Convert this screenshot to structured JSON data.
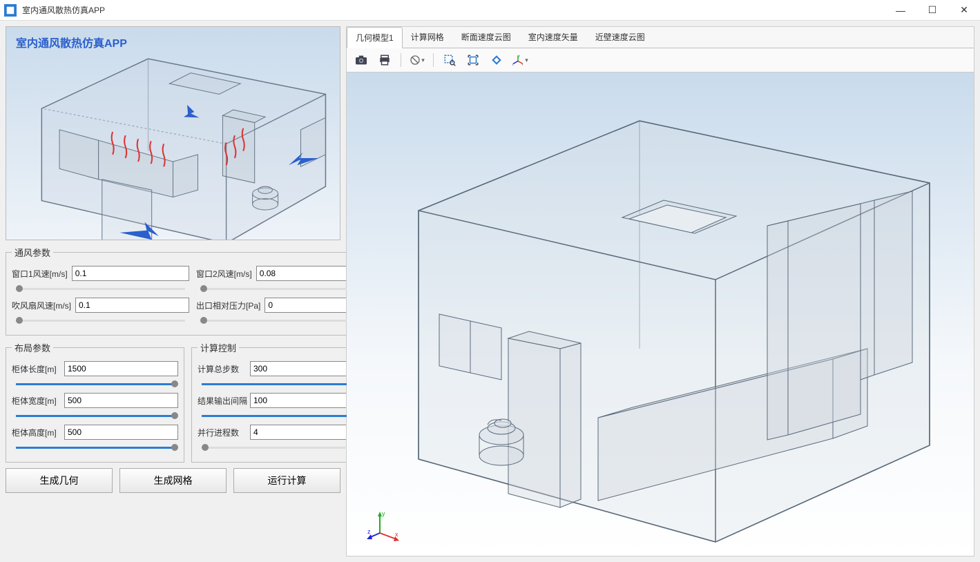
{
  "app": {
    "title": "室内通风散热仿真APP"
  },
  "preview": {
    "title": "室内通风散热仿真APP"
  },
  "vent": {
    "legend": "通风参数",
    "window1": {
      "label": "窗口1风速[m/s]",
      "value": "0.1"
    },
    "window2": {
      "label": "窗口2风速[m/s]",
      "value": "0.08"
    },
    "fan": {
      "label": "吹风扇风速[m/s]",
      "value": "0.1"
    },
    "outlet": {
      "label": "出口相对压力[Pa]",
      "value": "0"
    }
  },
  "layout": {
    "legend": "布局参数",
    "length": {
      "label": "柜体长度[m]",
      "value": "1500"
    },
    "width": {
      "label": "柜体宽度[m]",
      "value": "500"
    },
    "height": {
      "label": "柜体高度[m]",
      "value": "500"
    }
  },
  "control": {
    "legend": "计算控制",
    "steps": {
      "label": "计算总步数",
      "value": "300"
    },
    "interval": {
      "label": "结果输出间隔",
      "value": "100"
    },
    "procs": {
      "label": "并行进程数",
      "value": "4"
    }
  },
  "buttons": {
    "gen_geom": "生成几何",
    "gen_mesh": "生成网格",
    "run": "运行计算"
  },
  "tabs": {
    "t1": "几何模型1",
    "t2": "计算网格",
    "t3": "断面速度云图",
    "t4": "室内速度矢量",
    "t5": "近壁速度云图"
  },
  "win": {
    "min": "—",
    "max": "☐",
    "close": "✕"
  }
}
